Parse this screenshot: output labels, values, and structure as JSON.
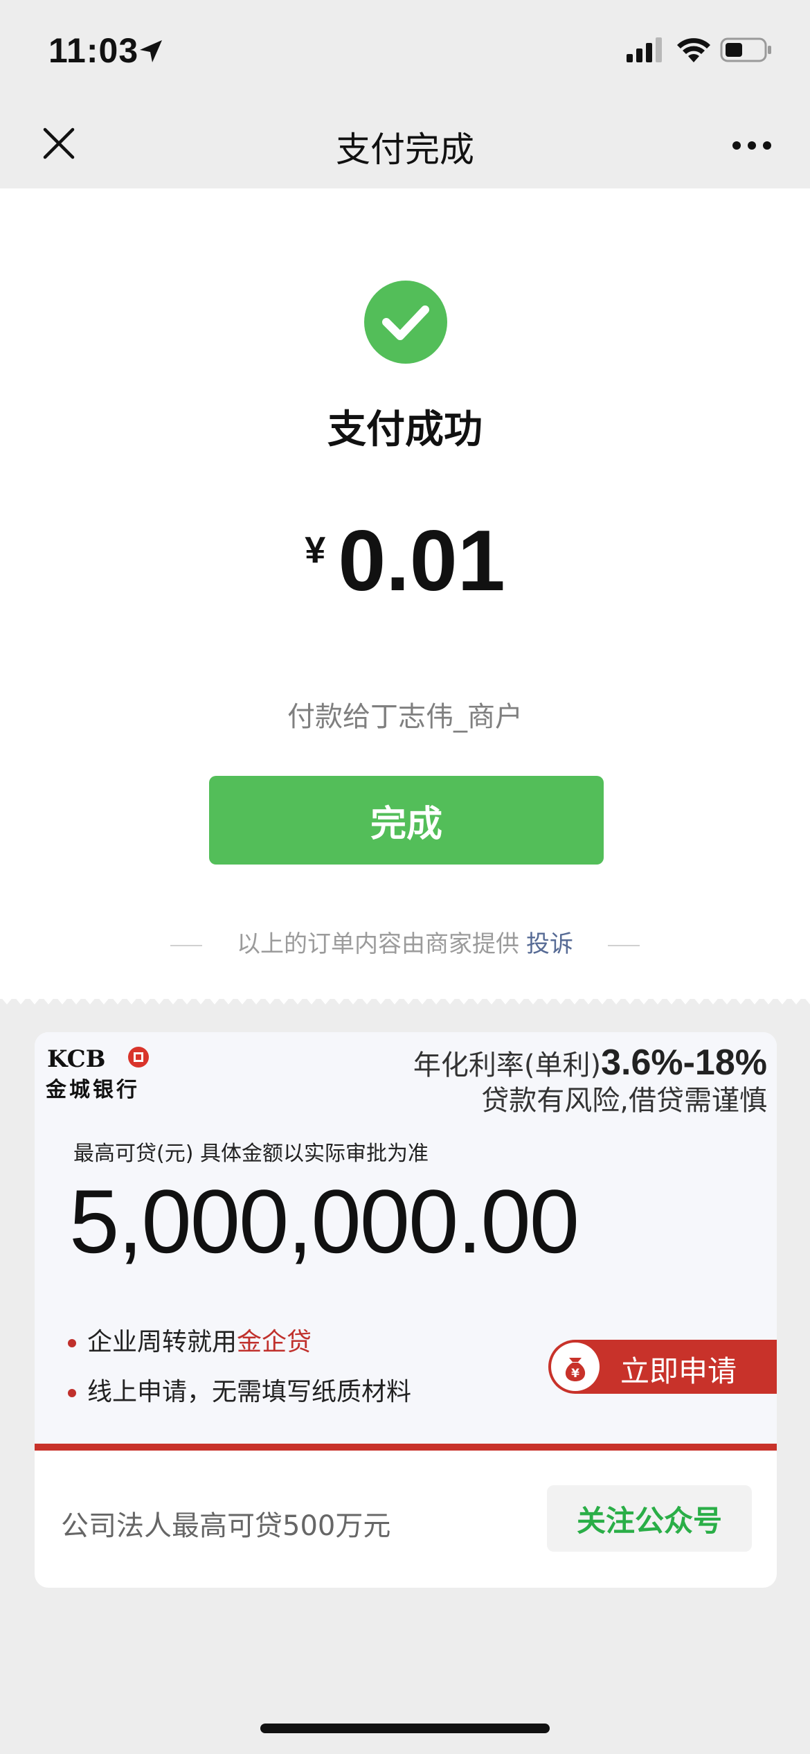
{
  "status_bar": {
    "time": "11:03",
    "icons": [
      "location-arrow-icon",
      "signal-icon",
      "wifi-icon",
      "battery-icon"
    ]
  },
  "nav": {
    "title": "支付完成",
    "close_icon": "close-icon",
    "more_icon": "more-icon"
  },
  "payment": {
    "status": "支付成功",
    "currency": "¥",
    "amount": "0.01",
    "payee": "付款给丁志伟_商户",
    "done_label": "完成",
    "footnote": "以上的订单内容由商家提供",
    "complaint_label": "投诉"
  },
  "ad": {
    "bank_logo": "KCB",
    "bank_name": "金城银行",
    "rate_label": "年化利率(单利)",
    "rate_value": "3.6%-18%",
    "risk_notice": "贷款有风险,借贷需谨慎",
    "limit_label": "最高可贷(元) 具体金额以实际审批为准",
    "limit_amount": "5,000,000.00",
    "bullet1_prefix": "企业周转就用",
    "bullet1_highlight": "金企贷",
    "bullet2": "线上申请，无需填写纸质材料",
    "apply_label": "立即申请",
    "bottom_text": "公司法人最高可贷500万元",
    "follow_label": "关注公众号"
  },
  "colors": {
    "success_green": "#53be59",
    "link_blue": "#576b95",
    "bank_red": "#c8322a",
    "follow_green": "#2aae47"
  }
}
